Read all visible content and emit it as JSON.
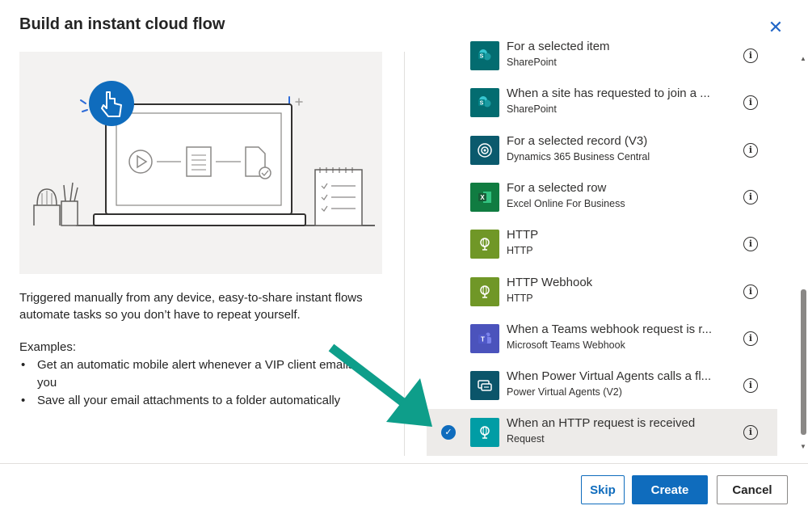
{
  "dialog": {
    "title": "Build an instant cloud flow",
    "close_icon": "close-icon"
  },
  "left_pane": {
    "description": "Triggered manually from any device, easy-to-share instant flows automate tasks so you don’t have to repeat yourself.",
    "examples_label": "Examples:",
    "examples": [
      "Get an automatic mobile alert whenever a VIP client emails you",
      "Save all your email attachments to a folder automatically"
    ]
  },
  "triggers": [
    {
      "name": "For a selected item",
      "connector": "SharePoint",
      "icon": "sharepoint-icon",
      "color": "#036c70"
    },
    {
      "name": "When a site has requested to join a ...",
      "connector": "SharePoint",
      "icon": "sharepoint-icon",
      "color": "#036c70"
    },
    {
      "name": "For a selected record (V3)",
      "connector": "Dynamics 365 Business Central",
      "icon": "dynamics-icon",
      "color": "#0b5a6d"
    },
    {
      "name": "For a selected row",
      "connector": "Excel Online For Business",
      "icon": "excel-icon",
      "color": "#107c41"
    },
    {
      "name": "HTTP",
      "connector": "HTTP",
      "icon": "globe-icon",
      "color": "#709727"
    },
    {
      "name": "HTTP Webhook",
      "connector": "HTTP",
      "icon": "globe-icon",
      "color": "#709727"
    },
    {
      "name": "When a Teams webhook request is r...",
      "connector": "Microsoft Teams Webhook",
      "icon": "teams-icon",
      "color": "#4b53bc"
    },
    {
      "name": "When Power Virtual Agents calls a fl...",
      "connector": "Power Virtual Agents (V2)",
      "icon": "chatbot-icon",
      "color": "#0b556a"
    },
    {
      "name": "When an HTTP request is received",
      "connector": "Request",
      "icon": "globe-icon",
      "color": "#009da5",
      "selected": true
    }
  ],
  "footer": {
    "skip_label": "Skip",
    "create_label": "Create",
    "cancel_label": "Cancel"
  },
  "colors": {
    "accent": "#0f6cbd",
    "annotation_arrow": "#0e9e8a",
    "selected_row": "#edebe9"
  }
}
